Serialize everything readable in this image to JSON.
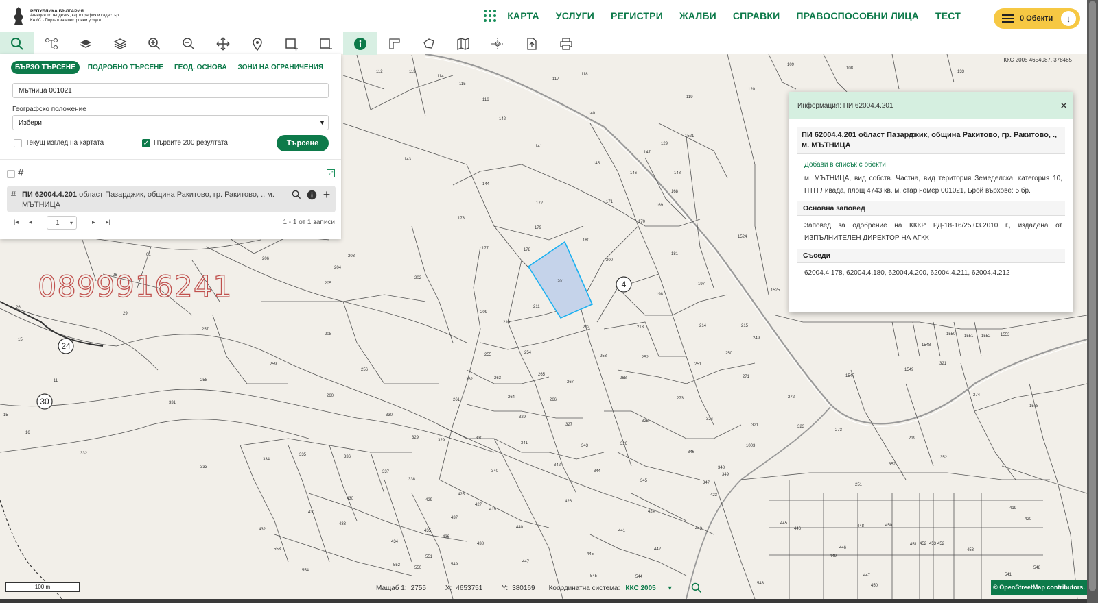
{
  "header": {
    "logo_lines": [
      "РЕПУБЛИКА БЪЛГАРИЯ",
      "Агенция по геодезия, картография и кадастър",
      "КАИС - Портал за електронни услуги"
    ],
    "nav": [
      "КАРТА",
      "УСЛУГИ",
      "РЕГИСТРИ",
      "ЖАЛБИ",
      "СПРАВКИ",
      "ПРАВОСПОСОБНИ ЛИЦА",
      "ТЕСТ"
    ],
    "cart_label": "0 Обекти"
  },
  "toolbar": {
    "tools": [
      "search-icon",
      "tree-icon",
      "layers-icon",
      "layers-stack-icon",
      "zoom-in-icon",
      "zoom-out-icon",
      "pan-icon",
      "pin-icon",
      "select-rect-icon",
      "deselect-rect-icon",
      "info-icon",
      "measure-icon",
      "polygon-icon",
      "map-icon",
      "crosshair-icon",
      "export-icon",
      "print-icon"
    ]
  },
  "search": {
    "tabs": [
      "БЪРЗО ТЪРСЕНЕ",
      "ПОДРОБНО ТЪРСЕНЕ",
      "ГЕОД. ОСНОВА",
      "ЗОНИ НА ОГРАНИЧЕНИЯ"
    ],
    "query": "Мътница 001021",
    "geo_label": "Географско положение",
    "geo_value": "Избери",
    "current_view_label": "Текущ изглед на картата",
    "first200_label": "Първите 200 резултата",
    "search_button": "Търсене",
    "result_bold": "ПИ 62004.4.201",
    "result_rest": " област Пазарджик, община Ракитово, гр. Ракитово, ., м. МЪТНИЦА",
    "page": "1",
    "records": "1 - 1 от 1 записи"
  },
  "info": {
    "header": "Информация: ПИ 62004.4.201",
    "title": "ПИ 62004.4.201 област Пазарджик, община Ракитово, гр. Ракитово, ., м. МЪТНИЦА",
    "add_link": "Добави в списък с обекти",
    "description": "м. МЪТНИЦА, вид собств. Частна, вид територия Земеделска, категория 10, НТП Ливада, площ 4743 кв. м, стар номер 001021, Брой върхове: 5 бр.",
    "order_title": "Основна заповед",
    "order_text": "Заповед за одобрение на КККР РД-18-16/25.03.2010 г., издадена от ИЗПЪЛНИТЕЛЕН ДИРЕКТОР НА АГКК",
    "neighbors_title": "Съседи",
    "neighbors": "62004.4.178, 62004.4.180, 62004.4.200, 62004.4.211, 62004.4.212"
  },
  "map": {
    "coord_top": "ККС 2005 4654087, 378485",
    "phone_watermark": "0899916241",
    "highlight_color": "#c5d3ea",
    "highlight_stroke": "#1ab0f0",
    "circled": [
      "24",
      "30",
      "4"
    ]
  },
  "status": {
    "scale_bar": "100 m",
    "scale_label": "Мащаб 1:",
    "scale_value": "2755",
    "x_label": "X:",
    "x_value": "4653751",
    "y_label": "Y:",
    "y_value": "380169",
    "coord_sys_label": "Координатна система:",
    "coord_sys_value": "ККС 2005",
    "osm": "© OpenStreetMap contributors."
  }
}
